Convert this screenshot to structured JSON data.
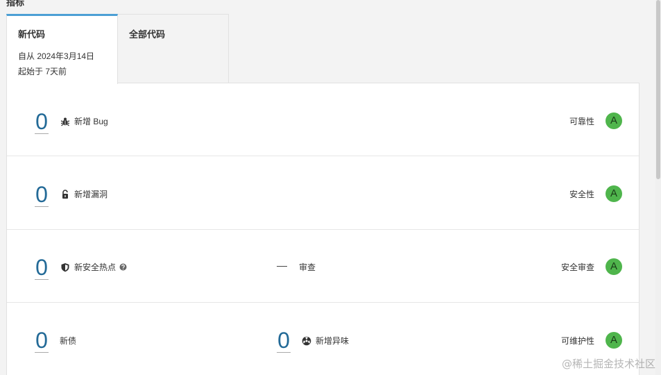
{
  "section_title": "指标",
  "tabs": [
    {
      "title": "新代码",
      "subtitle_line1": "自从 2024年3月14日",
      "subtitle_line2": "起始于 7天前"
    },
    {
      "title": "全部代码"
    }
  ],
  "rows": [
    {
      "value": "0",
      "label": "新增 Bug",
      "icon": "bug-icon",
      "rating_label": "可靠性",
      "rating": "A"
    },
    {
      "value": "0",
      "label": "新增漏洞",
      "icon": "lock-icon",
      "rating_label": "安全性",
      "rating": "A"
    },
    {
      "value": "0",
      "label": "新安全热点",
      "icon": "shield-icon",
      "middle_label": "审查",
      "rating_label": "安全审查",
      "rating": "A"
    },
    {
      "value": "0",
      "label": "新债",
      "middle_value": "0",
      "middle_label": "新增异味",
      "middle_icon": "smell-icon",
      "rating_label": "可维护性",
      "rating": "A"
    }
  ],
  "colors": {
    "accent": "#4b9fd5",
    "rating_a": "#4fb54c",
    "number": "#236a97"
  },
  "watermark": "@稀土掘金技术社区"
}
